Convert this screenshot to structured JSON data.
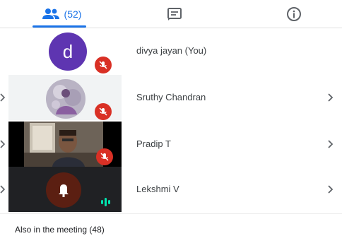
{
  "tabs": {
    "people_count": "(52)",
    "active": "people",
    "accent_color": "#1a73e8",
    "icons": [
      "people-icon",
      "chat-icon",
      "info-icon"
    ]
  },
  "participants": [
    {
      "name": "divya jayan (You)",
      "avatar_letter": "d",
      "avatar_color": "#5e35b1",
      "mic": "muted",
      "has_chevron": false
    },
    {
      "name": "Sruthy Chandran",
      "avatar": "photo",
      "mic": "muted",
      "has_chevron": true
    },
    {
      "name": "Pradip T",
      "avatar": "video",
      "mic": "muted",
      "has_chevron": true
    },
    {
      "name": "Lekshmi V",
      "avatar": "bell-icon",
      "mic": "speaking",
      "has_chevron": true
    }
  ],
  "section": {
    "also_in_meeting": "Also in the meeting (48)"
  },
  "colors": {
    "muted": "#d93025",
    "speaking": "#00e5b0"
  }
}
